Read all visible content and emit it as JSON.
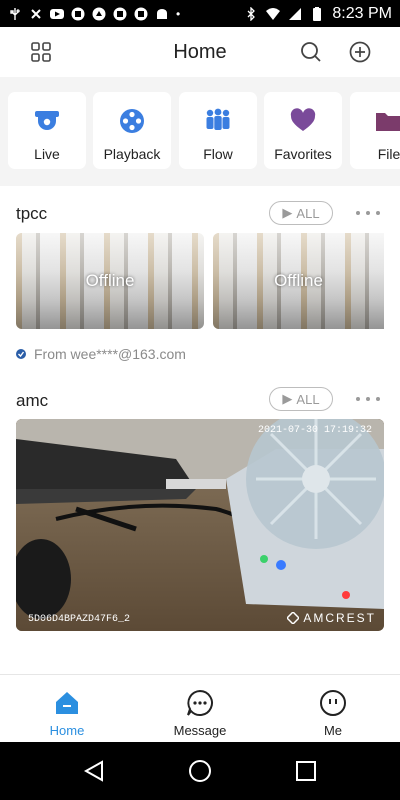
{
  "status_bar": {
    "time": "8:23 PM"
  },
  "header": {
    "title": "Home"
  },
  "tiles": [
    {
      "label": "Live",
      "icon": "camera-dome-icon"
    },
    {
      "label": "Playback",
      "icon": "playback-icon"
    },
    {
      "label": "Flow",
      "icon": "people-flow-icon"
    },
    {
      "label": "Favorites",
      "icon": "heart-icon"
    },
    {
      "label": "File",
      "icon": "folder-icon"
    }
  ],
  "groups": [
    {
      "name": "tpcc",
      "all_label": "ALL",
      "cameras": [
        {
          "status": "Offline"
        },
        {
          "status": "Offline"
        }
      ],
      "shared_from": "From wee****@163.com"
    },
    {
      "name": "amc",
      "all_label": "ALL",
      "camera": {
        "timestamp": "2021-07-30 17:19:32",
        "serial": "5D06D4BPAZD47F6_2",
        "brand": "AMCREST"
      }
    }
  ],
  "bottom_nav": [
    {
      "label": "Home",
      "active": true
    },
    {
      "label": "Message",
      "active": false
    },
    {
      "label": "Me",
      "active": false
    }
  ],
  "colors": {
    "accent": "#2b8fe0",
    "tile_icon": "#3b7ee0",
    "favorites": "#7a4a9a",
    "file": "#7b3b6b"
  }
}
